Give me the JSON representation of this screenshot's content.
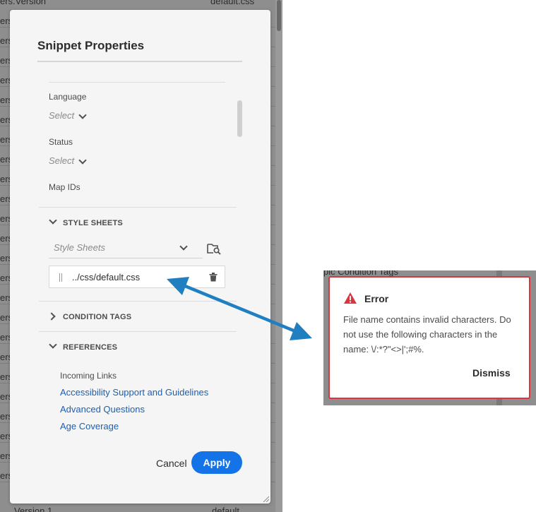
{
  "background_list": {
    "top_left": "ers.Version",
    "top_right": "default.css",
    "row_prefix": "ers",
    "bottom_left": "Version 1",
    "bottom_right": "default"
  },
  "dialog": {
    "title": "Snippet Properties",
    "language_label": "Language",
    "language_value": "Select",
    "status_label": "Status",
    "status_value": "Select",
    "map_ids_label": "Map IDs",
    "style_sheets_section": "STYLE SHEETS",
    "style_sheets_placeholder": "Style Sheets",
    "selected_file": "../css/default.css",
    "condition_tags_section": "CONDITION TAGS",
    "references_section": "REFERENCES",
    "incoming_links_label": "Incoming Links",
    "links": [
      "Accessibility Support and Guidelines",
      "Advanced Questions",
      "Age Coverage"
    ],
    "cancel_label": "Cancel",
    "apply_label": "Apply"
  },
  "error_popup": {
    "bg_text_top": "pic Condition Tags",
    "title": "Error",
    "message": "File name contains invalid characters. Do not use the following characters in the name: \\/:*?\"<>|';#%.",
    "dismiss_label": "Dismiss"
  },
  "colors": {
    "accent": "#1473e6",
    "error": "#d7373f",
    "arrow": "#1f7fc1",
    "link": "#1a5fb4"
  }
}
